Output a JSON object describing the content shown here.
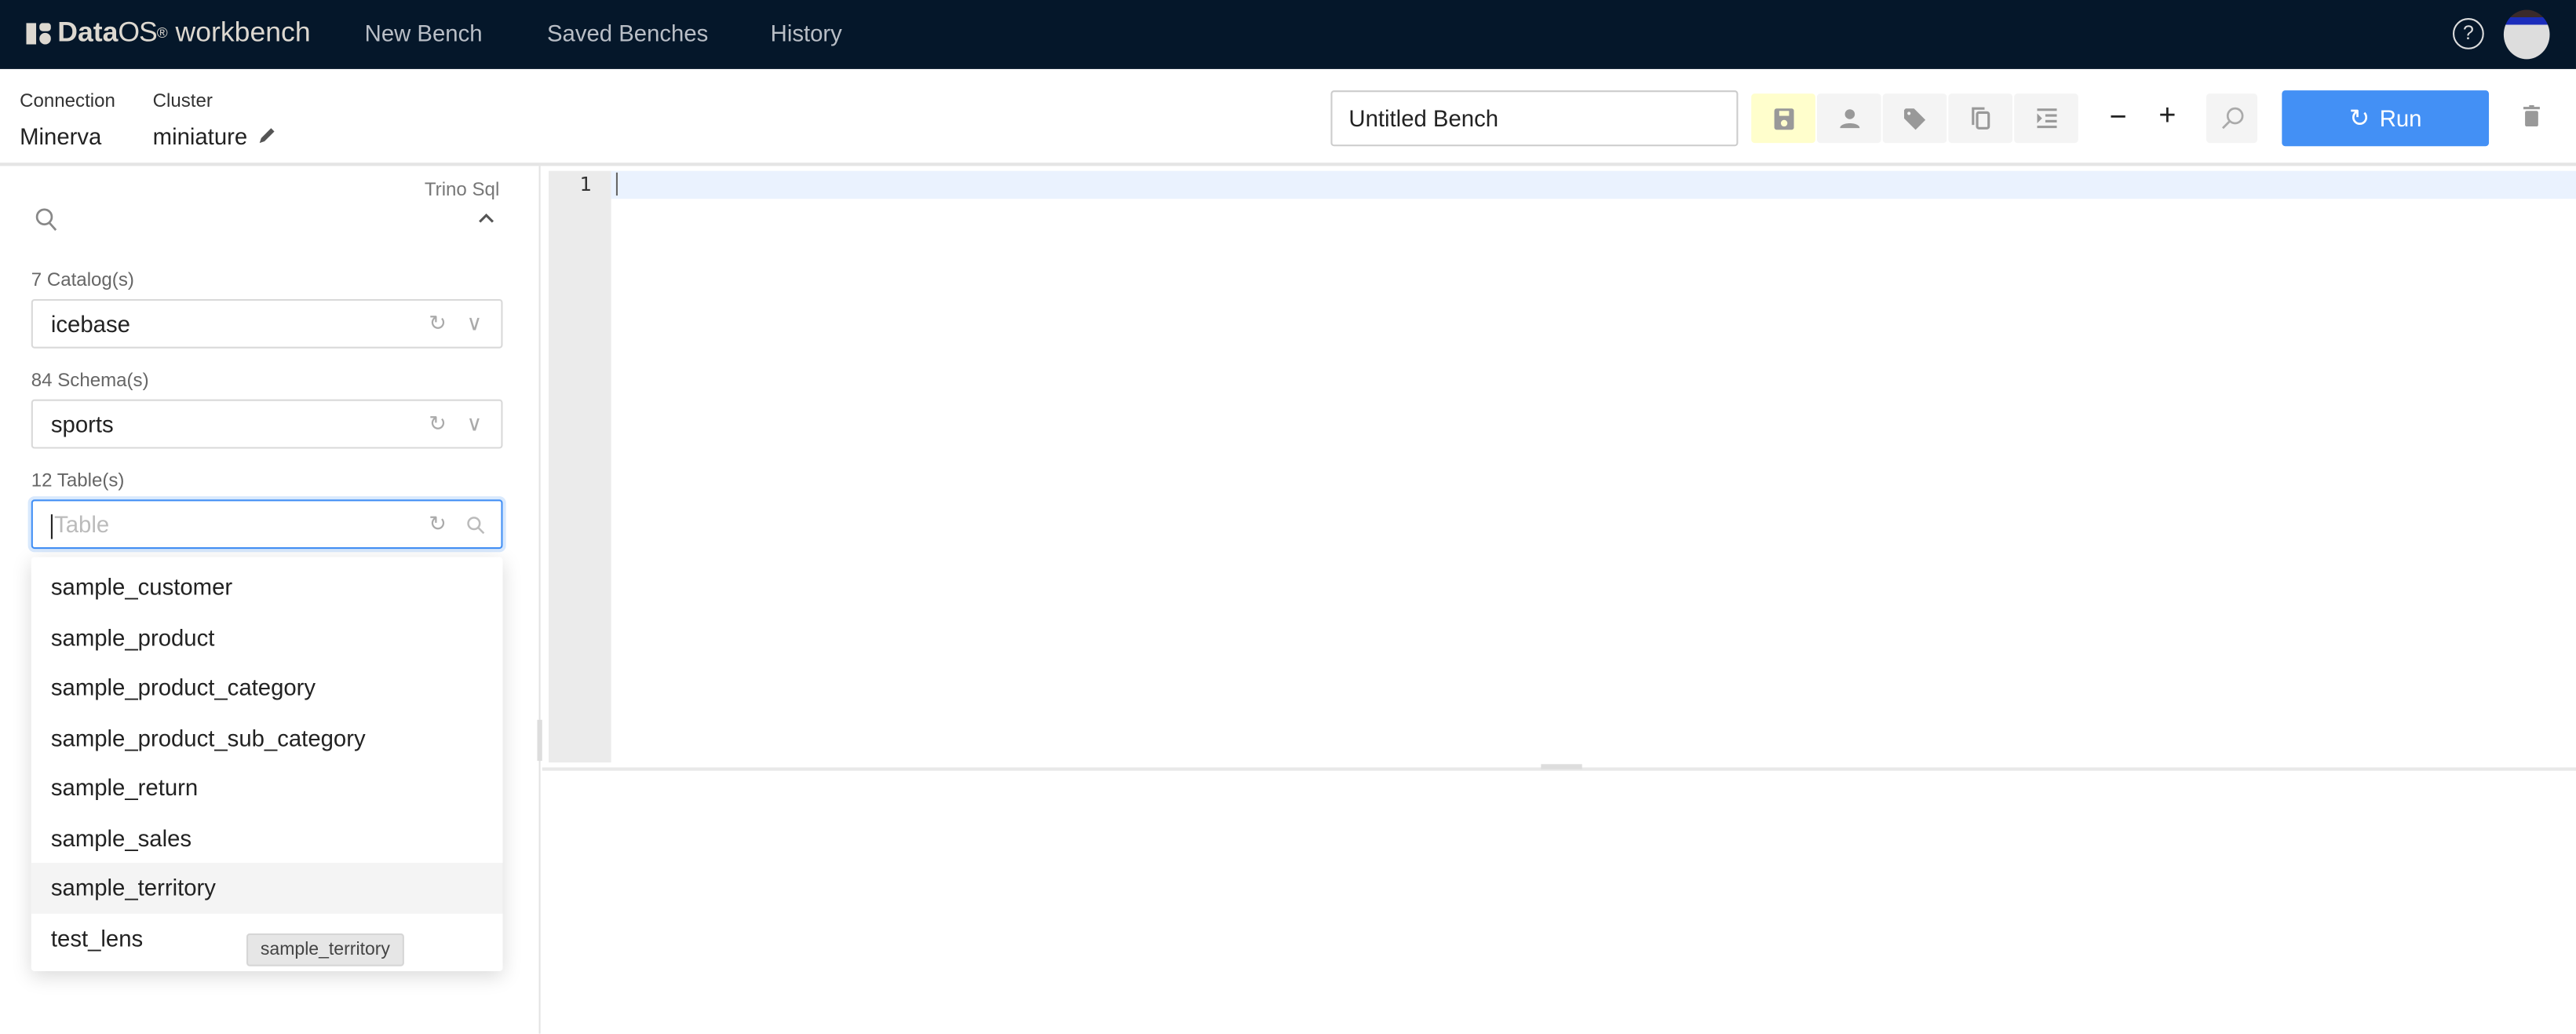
{
  "nav": {
    "brand_bold": "Data",
    "brand_os": "OS",
    "brand_reg": "®",
    "brand_suffix": "workbench",
    "items": [
      {
        "label": "New Bench"
      },
      {
        "label": "Saved Benches"
      },
      {
        "label": "History"
      }
    ],
    "help": "?"
  },
  "header": {
    "connection_label": "Connection",
    "connection_value": "Minerva",
    "cluster_label": "Cluster",
    "cluster_value": "miniature",
    "bench_name": "Untitled Bench",
    "run_label": "Run",
    "minus": "−",
    "plus": "+"
  },
  "toolbar_icons": [
    "save-icon",
    "share-user-icon",
    "tag-icon",
    "copy-icon",
    "format-indent-icon"
  ],
  "sidebar": {
    "dialect": "Trino Sql",
    "catalog_label": "7 Catalog(s)",
    "catalog_value": "icebase",
    "schema_label": "84 Schema(s)",
    "schema_value": "sports",
    "table_label": "12 Table(s)",
    "table_placeholder": "Table",
    "tables": [
      {
        "label": "sample_customer"
      },
      {
        "label": "sample_product"
      },
      {
        "label": "sample_product_category"
      },
      {
        "label": "sample_product_sub_category"
      },
      {
        "label": "sample_return"
      },
      {
        "label": "sample_sales"
      },
      {
        "label": "sample_territory"
      },
      {
        "label": "test_lens"
      }
    ],
    "hovered": "sample_territory",
    "tooltip": "sample_territory"
  },
  "editor": {
    "line_numbers": [
      "1"
    ]
  },
  "colors": {
    "nav_bg": "#05172a",
    "run": "#4390f5",
    "save_highlight": "#fffecc",
    "focus": "#4390f5"
  }
}
